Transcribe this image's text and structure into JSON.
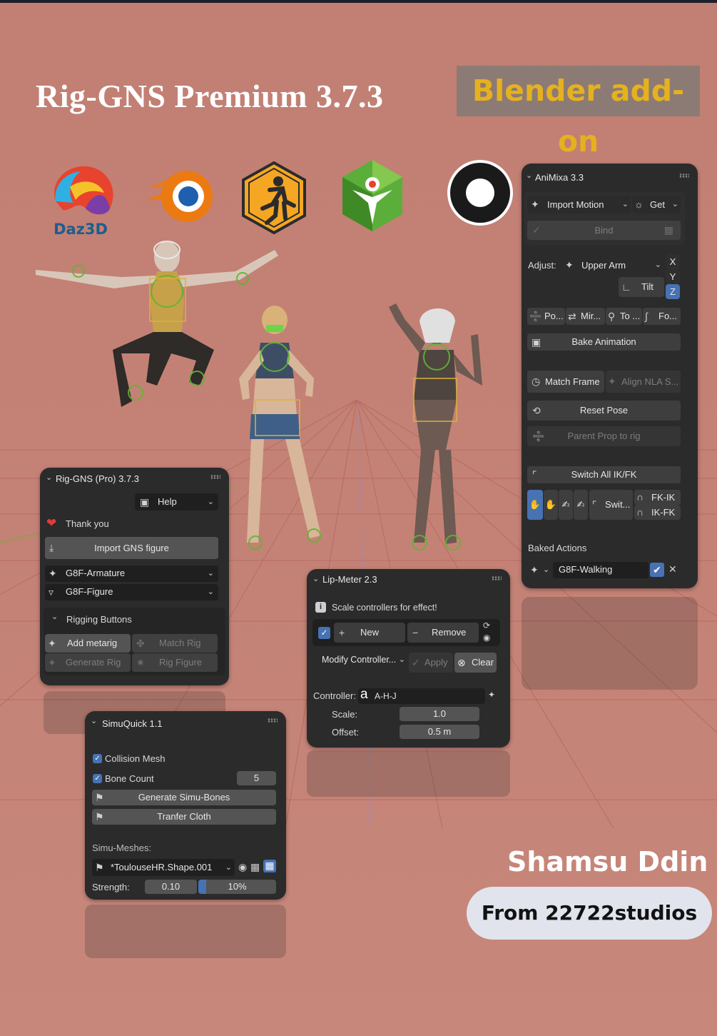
{
  "header": {
    "title": "Rig-GNS Premium 3.7.3",
    "tag": "Blender add-on",
    "daz_logo_text": "Daz3D"
  },
  "colors": {
    "background": "#c48276",
    "panel": "#2b2b2b",
    "button": "#545454",
    "accent_blue": "#4772b3",
    "tag_text": "#e6b11e",
    "tag_bg": "#8c7b74"
  },
  "rig_panel": {
    "title": "Rig-GNS (Pro) 3.7.3",
    "help": "Help",
    "thank_you": "Thank you",
    "import": "Import GNS figure",
    "armature": "G8F-Armature",
    "figure": "G8F-Figure",
    "rigging_header": "Rigging Buttons",
    "add_metarig": "Add metarig",
    "match_rig": "Match Rig",
    "generate_rig": "Generate Rig",
    "rig_figure": "Rig Figure"
  },
  "simu_panel": {
    "title": "SimuQuick 1.1",
    "collision_mesh": "Collision Mesh",
    "bone_count_label": "Bone Count",
    "bone_count_value": "5",
    "generate": "Generate Simu-Bones",
    "transfer": "Tranfer Cloth",
    "meshes_label": "Simu-Meshes:",
    "mesh_value": "*ToulouseHR.Shape.001",
    "strength_label": "Strength:",
    "strength_value": "0.10",
    "strength_percent": "10%",
    "strength_fraction": 0.1
  },
  "lip_panel": {
    "title": "Lip-Meter 2.3",
    "info": "Scale controllers for effect!",
    "new": "New",
    "remove": "Remove",
    "modify": "Modify Controller...",
    "apply": "Apply",
    "clear": "Clear",
    "controller_label": "Controller:",
    "controller_value": "A-H-J",
    "scale_label": "Scale:",
    "scale_value": "1.0",
    "offset_label": "Offset:",
    "offset_value": "0.5 m"
  },
  "animixa_panel": {
    "title": "AniMixa 3.3",
    "import_motion": "Import Motion",
    "get": "Get",
    "bind": "Bind",
    "adjust_label": "Adjust:",
    "adjust_value": "Upper Arm",
    "tilt": "Tilt",
    "x": "X",
    "y": "Y",
    "z": "Z",
    "pose": "Po...",
    "mirror": "Mir...",
    "to": "To ...",
    "fo": "Fo...",
    "bake": "Bake Animation",
    "match_frame": "Match Frame",
    "align_nla": "Align NLA S...",
    "reset_pose": "Reset Pose",
    "parent_prop": "Parent Prop to rig",
    "switch_all": "Switch All IK/FK",
    "swit": "Swit...",
    "fk_ik": "FK-IK",
    "ik_fk": "IK-FK",
    "baked_actions": "Baked Actions",
    "action_value": "G8F-Walking"
  },
  "footer": {
    "author": "Shamsu Ddin",
    "studio": "From 22722studios"
  }
}
